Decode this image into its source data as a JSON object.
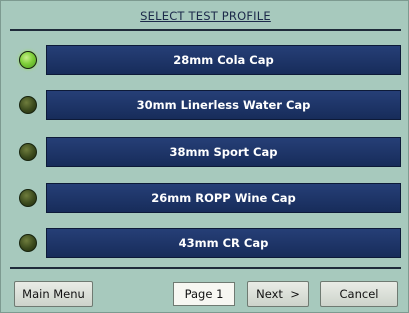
{
  "title": "SELECT TEST PROFILE",
  "colors": {
    "background": "#a7c9bd",
    "button": "#1e3468",
    "led_active": "#7fcf3a",
    "led_inactive": "#3b4a1d"
  },
  "profiles": [
    {
      "label": "28mm Cola Cap",
      "active": true
    },
    {
      "label": "30mm Linerless Water Cap",
      "active": false
    },
    {
      "label": "38mm Sport Cap",
      "active": false
    },
    {
      "label": "26mm ROPP Wine Cap",
      "active": false
    },
    {
      "label": "43mm CR Cap",
      "active": false
    }
  ],
  "footer": {
    "main_menu_label": "Main Menu",
    "page_label": "Page 1",
    "next_label": "Next  >",
    "cancel_label": "Cancel"
  }
}
